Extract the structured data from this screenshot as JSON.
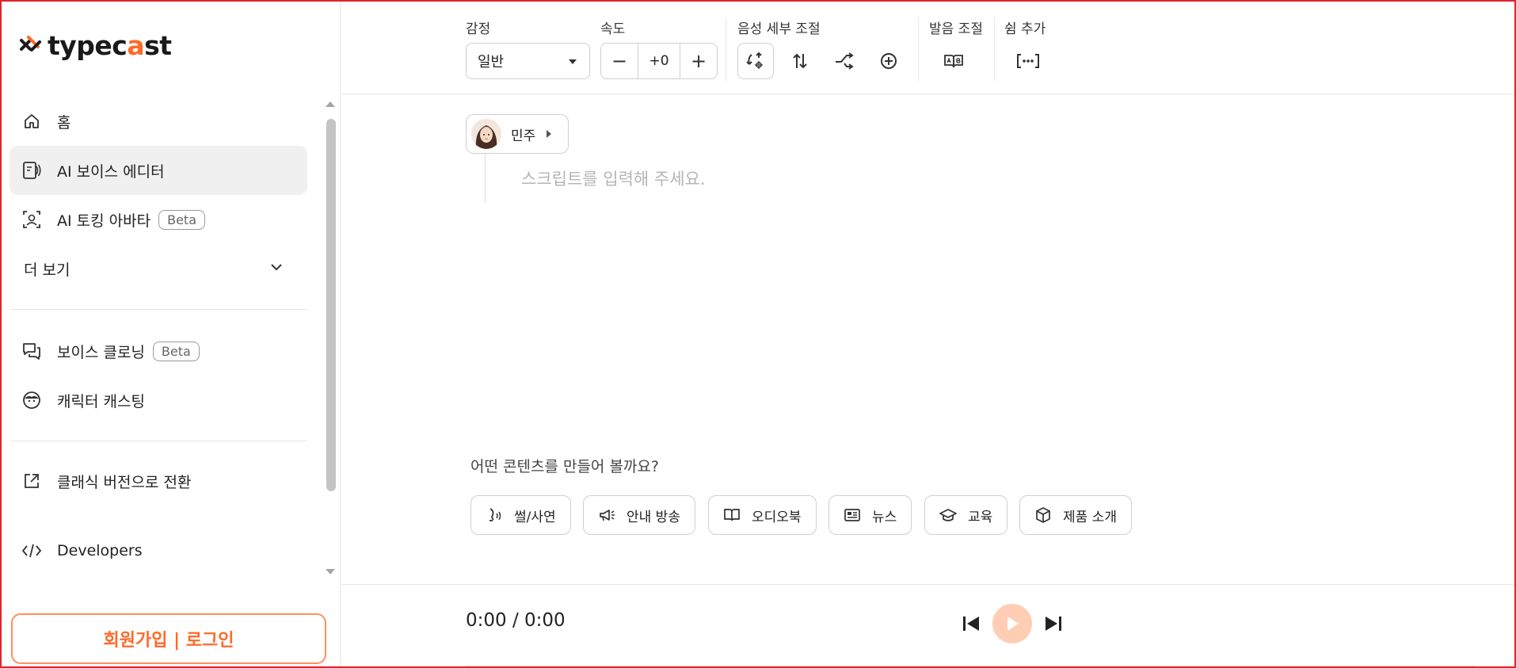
{
  "brand": {
    "logo_text_a": "typec",
    "logo_text_b": "a",
    "logo_text_c": "st",
    "accent_color": "#ff6a2a"
  },
  "sidebar": {
    "items": [
      {
        "label": "홈",
        "icon": "home-icon"
      },
      {
        "label": "AI 보이스 에디터",
        "icon": "voice-editor-icon",
        "active": true
      },
      {
        "label": "AI 토킹 아바타",
        "icon": "avatar-icon",
        "badge": "Beta"
      },
      {
        "label": "더 보기",
        "icon": "chevron-down-icon"
      },
      {
        "label": "보이스 클로닝",
        "icon": "chat-icon",
        "badge": "Beta"
      },
      {
        "label": "캐릭터 캐스팅",
        "icon": "character-face-icon"
      },
      {
        "label": "클래식 버전으로 전환",
        "icon": "external-link-icon"
      },
      {
        "label": "Developers",
        "icon": "code-icon"
      }
    ],
    "login_label": "회원가입 | 로그인"
  },
  "toolbar": {
    "emotion_label": "감정",
    "emotion_value": "일반",
    "speed_label": "속도",
    "speed_minus": "−",
    "speed_value": "+0",
    "speed_plus": "+",
    "voice_detail_label": "음성 세부 조절",
    "pronunciation_label": "발음 조절",
    "pause_label": "쉼 추가"
  },
  "editor": {
    "speaker_name": "민주",
    "placeholder": "스크립트를 입력해 주세요.",
    "question": "어떤 콘텐츠를 만들어 볼까요?",
    "chips": [
      {
        "label": "썰/사연",
        "icon": "story-icon"
      },
      {
        "label": "안내 방송",
        "icon": "megaphone-icon"
      },
      {
        "label": "오디오북",
        "icon": "book-icon"
      },
      {
        "label": "뉴스",
        "icon": "news-icon"
      },
      {
        "label": "교육",
        "icon": "graduation-cap-icon"
      },
      {
        "label": "제품 소개",
        "icon": "box-icon"
      }
    ]
  },
  "player": {
    "time": "0:00 / 0:00"
  }
}
